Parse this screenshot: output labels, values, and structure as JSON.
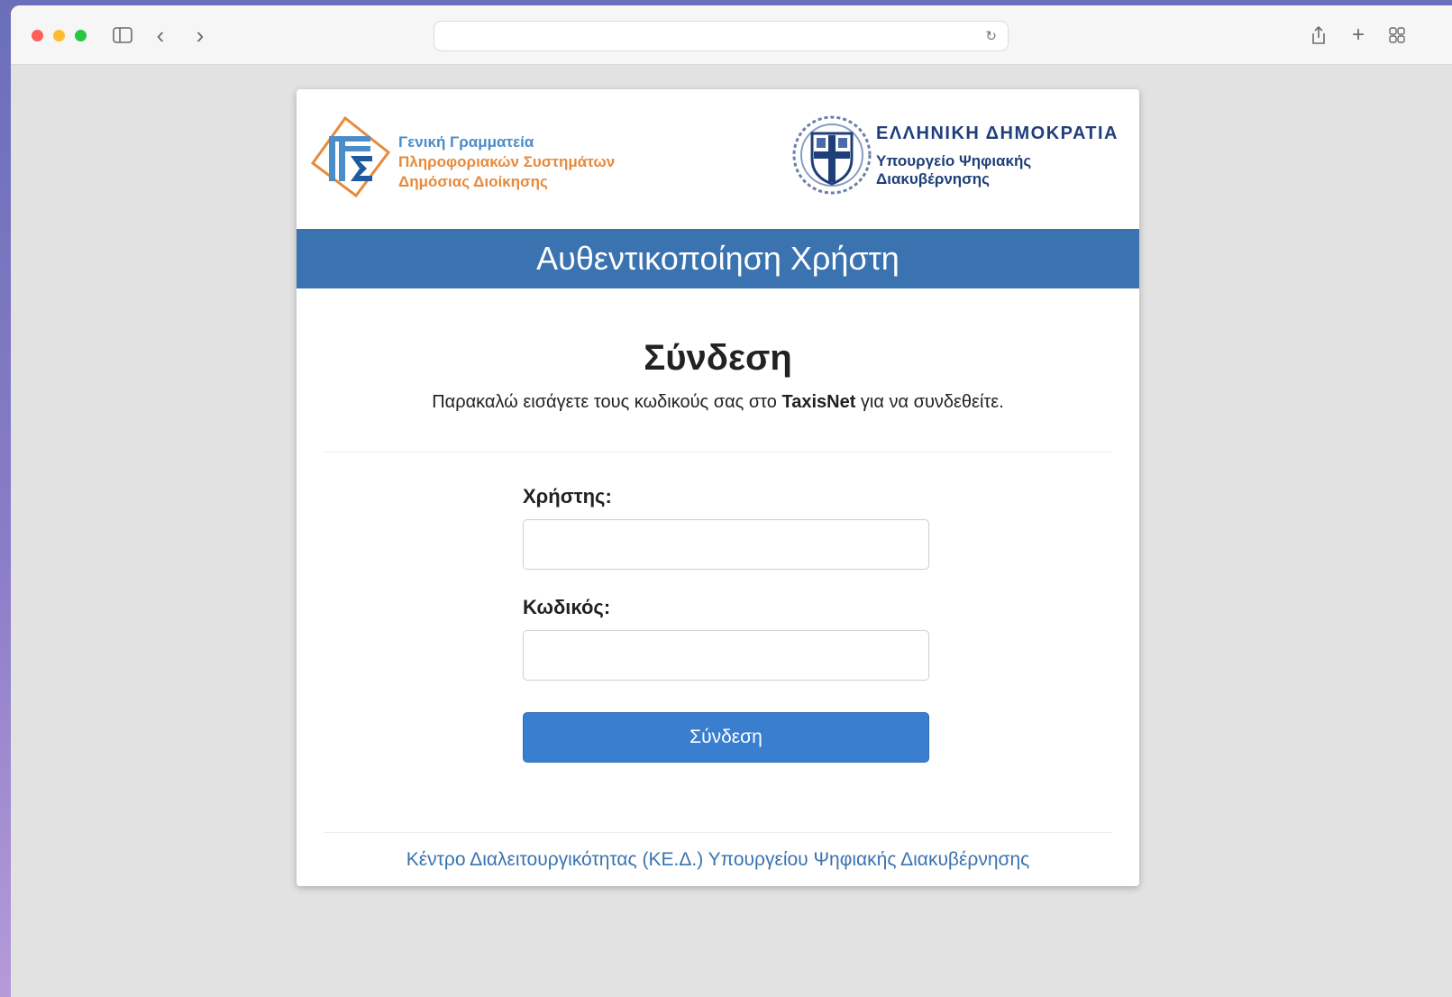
{
  "browser": {
    "address_value": "",
    "icons": [
      "sidebar-icon",
      "back-icon",
      "forward-icon",
      "reload-icon",
      "share-icon",
      "new-tab-icon",
      "tab-overview-icon"
    ]
  },
  "header": {
    "gsis_line1": "Γενική Γραμματεία",
    "gsis_line2": "Πληροφοριακών Συστημάτων",
    "gsis_line3": "Δημόσιας Διοίκησης",
    "gov_line1": "ΕΛΛΗΝΙΚΗ ΔΗΜΟΚΡΑΤΙΑ",
    "gov_line2": "Υπουργείο Ψηφιακής",
    "gov_line3": "Διακυβέρνησης"
  },
  "banner": {
    "title": "Αυθεντικοποίηση Χρήστη"
  },
  "login": {
    "title": "Σύνδεση",
    "instructions_before": "Παρακαλώ εισάγετε τους κωδικούς σας στο ",
    "instructions_bold": "TaxisNet",
    "instructions_after": " για να συνδεθείτε.",
    "username_label": "Χρήστης:",
    "username_value": "",
    "password_label": "Κωδικός:",
    "password_value": "",
    "submit_label": "Σύνδεση"
  },
  "footer": {
    "link_text": "Κέντρο Διαλειτουργικότητας (ΚΕ.Δ.) Υπουργείου Ψηφιακής Διακυβέρνησης"
  },
  "colors": {
    "banner": "#3a73b0",
    "button": "#3a7fcf",
    "gsis_blue": "#4a8dc8",
    "gsis_orange": "#e68a3c",
    "gov_navy": "#1f3f7a"
  }
}
